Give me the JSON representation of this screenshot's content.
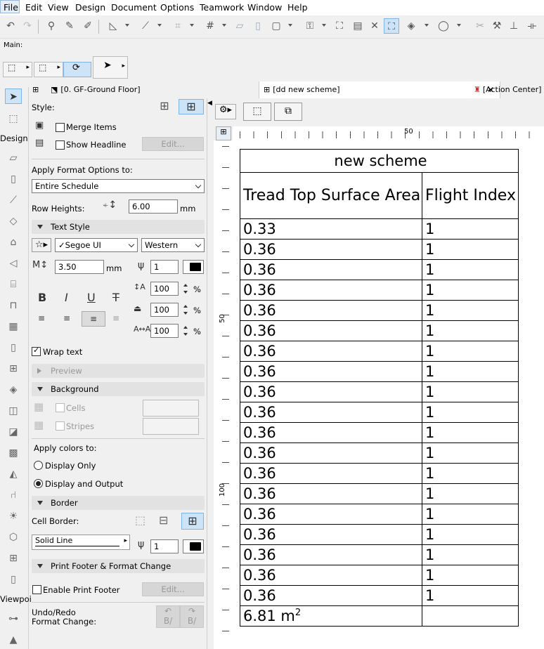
{
  "menu": [
    "File",
    "Edit",
    "View",
    "Design",
    "Document",
    "Options",
    "Teamwork",
    "Window",
    "Help"
  ],
  "main_toolbar": {
    "label": "Main:"
  },
  "tabs": {
    "floor": "[0. GF-Ground Floor]",
    "schedule": "[dd new scheme]",
    "action_center": "[Action Center]"
  },
  "toolbox": {
    "design_label": "Design",
    "viewpoint_label": "Viewpoi"
  },
  "panel": {
    "style_label": "Style:",
    "merge_items": "Merge Items",
    "show_headline": "Show Headline",
    "edit_button": "Edit...",
    "apply_format_label": "Apply Format Options to:",
    "apply_format_value": "Entire Schedule",
    "row_heights_label": "Row Heights:",
    "row_heights_value": "6.00",
    "row_heights_unit": "mm",
    "text_style_section": "Text Style",
    "font_value": "Segoe UI",
    "script_value": "Western",
    "text_size_value": "3.50",
    "text_size_unit": "mm",
    "pen_value": "1",
    "spacing_values": [
      "100",
      "100",
      "100"
    ],
    "percent": "%",
    "wrap_text": "Wrap text",
    "preview_section": "Preview",
    "background_section": "Background",
    "cells": "Cells",
    "stripes": "Stripes",
    "apply_colors_label": "Apply colors to:",
    "display_only": "Display Only",
    "display_and_output": "Display and Output",
    "border_section": "Border",
    "cell_border_label": "Cell Border:",
    "line_type_value": "Solid Line",
    "border_pen_value": "1",
    "print_footer_section": "Print Footer & Format Change",
    "enable_print_footer": "Enable Print Footer",
    "print_footer_edit": "Edit...",
    "undo_redo_label": "Undo/Redo",
    "format_change_label": "Format Change:"
  },
  "ruler": {
    "top_mark": "50",
    "left_marks": [
      "50",
      "100"
    ]
  },
  "schedule": {
    "title": "new scheme",
    "headers": [
      "Tread Top Surface Area",
      "Flight Index"
    ],
    "rows": [
      [
        "0.33",
        "1"
      ],
      [
        "0.36",
        "1"
      ],
      [
        "0.36",
        "1"
      ],
      [
        "0.36",
        "1"
      ],
      [
        "0.36",
        "1"
      ],
      [
        "0.36",
        "1"
      ],
      [
        "0.36",
        "1"
      ],
      [
        "0.36",
        "1"
      ],
      [
        "0.36",
        "1"
      ],
      [
        "0.36",
        "1"
      ],
      [
        "0.36",
        "1"
      ],
      [
        "0.36",
        "1"
      ],
      [
        "0.36",
        "1"
      ],
      [
        "0.36",
        "1"
      ],
      [
        "0.36",
        "1"
      ],
      [
        "0.36",
        "1"
      ],
      [
        "0.36",
        "1"
      ],
      [
        "0.36",
        "1"
      ],
      [
        "0.36",
        "1"
      ]
    ],
    "total": "6.81 m",
    "total_sup": "2"
  },
  "colors": {
    "accent": "#0078d7",
    "selected_bg": "#cde3f7",
    "section_bg": "#e2e2e2"
  }
}
